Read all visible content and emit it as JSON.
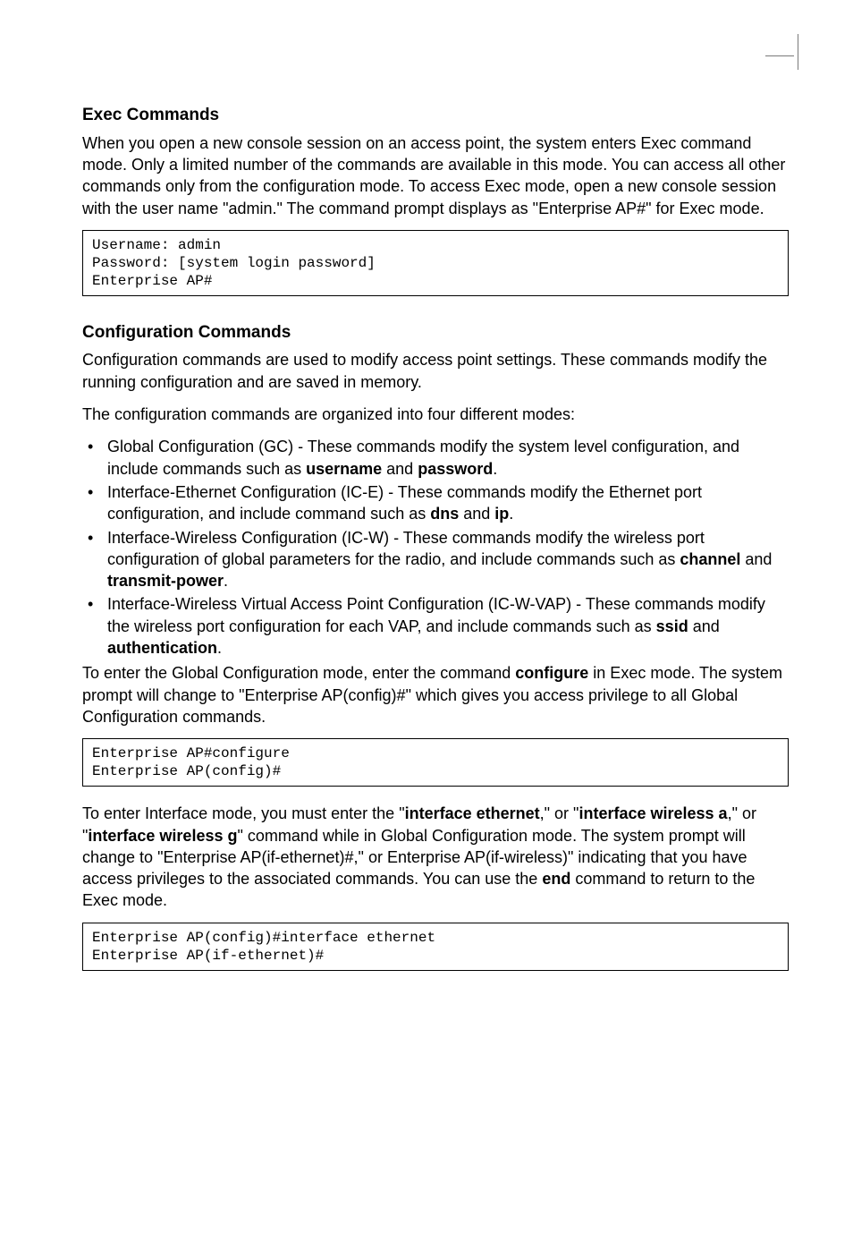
{
  "section1": {
    "title": "Exec Commands",
    "para1": "When you open a new console session on an access point, the system enters Exec command mode. Only a limited number of the commands are available in this mode. You can access all other commands only from the configuration mode. To access Exec mode, open a new console session with the user name \"admin.\" The command prompt displays as \"Enterprise AP#\" for Exec mode.",
    "code": "Username: admin\nPassword: [system login password]\nEnterprise AP#"
  },
  "section2": {
    "title": "Configuration Commands",
    "para1": "Configuration commands are used to modify access point settings. These commands modify the running configuration and are saved in memory.",
    "para2": "The configuration commands are organized into four different modes:",
    "b1": {
      "pre": "Global Configuration (GC) - These commands modify the system level configuration, and include commands such as ",
      "cmd1": "username",
      "mid": " and ",
      "cmd2": "password",
      "suf": "."
    },
    "b2": {
      "pre": "Interface-Ethernet Configuration (IC-E) - These commands modify the Ethernet port configuration, and include command such as ",
      "cmd1": "dns",
      "mid": " and ",
      "cmd2": "ip",
      "suf": "."
    },
    "b3": {
      "pre": "Interface-Wireless Configuration (IC-W) - These commands modify the wireless port configuration of global parameters for the radio, and include commands such as ",
      "cmd1": "channel",
      "mid": " and ",
      "cmd2": "transmit-power",
      "suf": "."
    },
    "b4": {
      "pre": "Interface-Wireless Virtual Access Point Configuration (IC-W-VAP) - These commands modify the wireless port configuration for each VAP, and include commands such as ",
      "cmd1": "ssid",
      "mid": " and ",
      "cmd2": "authentication",
      "suf": "."
    },
    "para3": {
      "pre": "To enter the Global Configuration mode, enter the command ",
      "cmd": "configure",
      "suf": " in Exec mode. The system prompt will change to \"Enterprise AP(config)#\" which gives you access privilege to all Global Configuration commands."
    },
    "code1": "Enterprise AP#configure\nEnterprise AP(config)#",
    "para4": {
      "pre": "To enter Interface mode, you must enter the \"",
      "cmd1": "interface ethernet",
      "m1": ",\" or \"",
      "cmd2": "interface wireless a",
      "m2": ",\" or \"",
      "cmd3": "interface wireless g",
      "m3": "\" command while in Global Configuration mode. The system prompt will change to \"Enterprise AP(if-ethernet)#,\" or Enterprise AP(if-wireless)\" indicating that you have access privileges to the associated commands. You can use the ",
      "cmd4": "end",
      "suf": " command to return to the Exec mode."
    },
    "code2": "Enterprise AP(config)#interface ethernet\nEnterprise AP(if-ethernet)#"
  }
}
